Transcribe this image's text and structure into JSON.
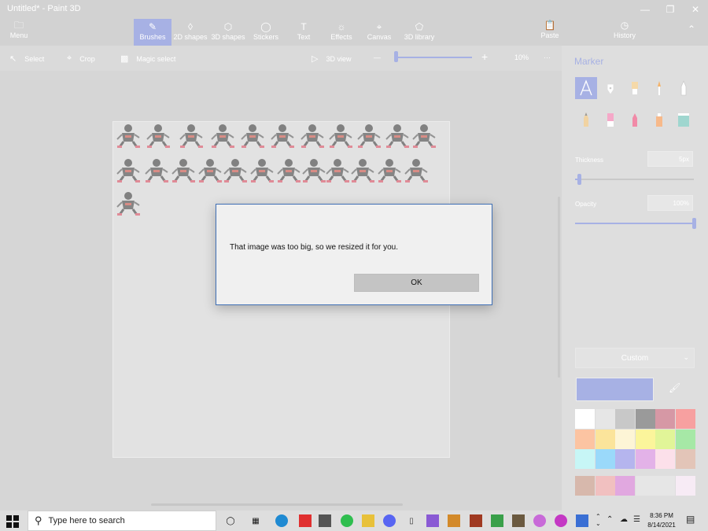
{
  "window": {
    "title": "Untitled* - Paint 3D",
    "minimize_icon": "minimize-icon",
    "restore_icon": "restore-icon",
    "close_icon": "close-icon"
  },
  "ribbon": {
    "menu_label": "Menu",
    "tabs": [
      {
        "label": "Brushes",
        "icon": "brush-icon"
      },
      {
        "label": "2D shapes",
        "icon": "shapes-2d-icon"
      },
      {
        "label": "3D shapes",
        "icon": "cube-icon"
      },
      {
        "label": "Stickers",
        "icon": "sticker-icon"
      },
      {
        "label": "Text",
        "icon": "text-icon"
      },
      {
        "label": "Effects",
        "icon": "sun-icon"
      },
      {
        "label": "Canvas",
        "icon": "canvas-icon"
      },
      {
        "label": "3D library",
        "icon": "library-icon"
      }
    ],
    "paste_label": "Paste",
    "history_label": "History"
  },
  "toolbar": {
    "select_label": "Select",
    "crop_label": "Crop",
    "magic_select_label": "Magic select",
    "view_3d_label": "3D view",
    "zoom_minus": "—",
    "zoom_plus": "+",
    "zoom_value": "10%",
    "more": "···"
  },
  "panel": {
    "title": "Marker",
    "brushes": [
      "marker",
      "calligraphy-pen",
      "oil-brush",
      "watercolor",
      "pixel-pen",
      "pencil",
      "eraser",
      "crayon",
      "spray-can",
      "fill"
    ],
    "thickness_label": "Thickness",
    "thickness_value": "5px",
    "thickness_level": 0.03,
    "opacity_label": "Opacity",
    "opacity_value": "100%",
    "opacity_level": 1.0,
    "color_mode": "Custom",
    "current_color": "#a7b1e4",
    "palette": [
      "#ffffff",
      "#e6e6e6",
      "#c8c8c8",
      "#9a9a9a",
      "#d698a5",
      "#f7a0a0",
      "#fcc4a2",
      "#fbe49b",
      "#fdf5d6",
      "#fbf59b",
      "#e1f598",
      "#a6e8a6",
      "#c7f6f6",
      "#9ad9fa",
      "#b5b5ee",
      "#e3b2e8",
      "#fce0ea",
      "#e3c5b8",
      "#d7b8ac",
      "#f1c0c0",
      "#e1a8e0",
      "#e6e6e6",
      "#e6e6e6",
      "#f7ebf5"
    ]
  },
  "dialog": {
    "message": "That image was too big, so we resized it for you.",
    "ok_label": "OK"
  },
  "taskbar": {
    "search_placeholder": "Type here to search",
    "time": "8:36 PM",
    "date": "8/14/2021"
  }
}
